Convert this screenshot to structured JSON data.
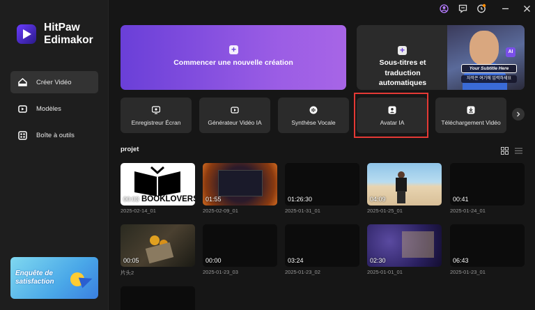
{
  "app": {
    "name_line1": "HitPaw",
    "name_line2": "Edimakor"
  },
  "sidebar": {
    "items": [
      {
        "label": "Créer Vidéo",
        "icon": "home-icon",
        "active": true
      },
      {
        "label": "Modèles",
        "icon": "templates-icon",
        "active": false
      },
      {
        "label": "Boîte à outils",
        "icon": "toolbox-icon",
        "active": false
      }
    ],
    "survey": {
      "line1": "Enquête de",
      "line2": "satisfaction"
    }
  },
  "hero": {
    "new_creation": "Commencer une nouvelle création",
    "subtitles": {
      "line1": "Sous-titres et",
      "line2": "traduction",
      "line3": "automatiques"
    },
    "subtitle_preview": {
      "caption1": "Your Subtitle Here",
      "caption2": "자막은 여기에 입력하세요",
      "ai_tag": "AI"
    }
  },
  "tools": [
    {
      "label": "Enregistreur Écran",
      "icon": "screen-record-icon"
    },
    {
      "label": "Générateur Vidéo IA",
      "icon": "ai-video-icon"
    },
    {
      "label": "Synthèse Vocale",
      "icon": "voice-icon"
    },
    {
      "label": "Avatar IA",
      "icon": "avatar-icon"
    },
    {
      "label": "Téléchargement Vidéo",
      "icon": "download-icon"
    }
  ],
  "projects": {
    "title": "projet",
    "items": [
      {
        "duration": "00:03",
        "name": "2025-02-14_01",
        "thumb": "booklovers",
        "thumb_text": "BOOKLOVERS"
      },
      {
        "duration": "01:55",
        "name": "2025-02-09_01",
        "thumb": "fire"
      },
      {
        "duration": "01:26:30",
        "name": "2025-01-31_01",
        "thumb": "black"
      },
      {
        "duration": "04:09",
        "name": "2025-01-25_01",
        "thumb": "beach"
      },
      {
        "duration": "00:41",
        "name": "2025-01-24_01",
        "thumb": "black"
      },
      {
        "duration": "00:05",
        "name": "片头2",
        "thumb": "flowers"
      },
      {
        "duration": "00:00",
        "name": "2025-01-23_03",
        "thumb": "black"
      },
      {
        "duration": "03:24",
        "name": "2025-01-23_02",
        "thumb": "black"
      },
      {
        "duration": "02:30",
        "name": "2025-01-01_01",
        "thumb": "purple"
      },
      {
        "duration": "06:43",
        "name": "2025-01-23_01",
        "thumb": "black"
      }
    ]
  },
  "colors": {
    "accent": "#8a4fe0",
    "highlight": "#e53935",
    "background": "#161616"
  }
}
